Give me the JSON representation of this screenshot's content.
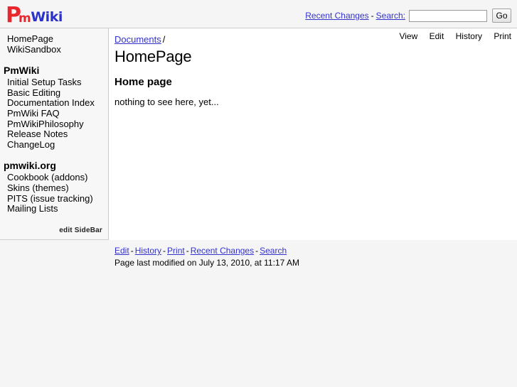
{
  "header": {
    "logo": {
      "p": "P",
      "m": "m",
      "wiki": "Wiki",
      "alt": "PmWiki"
    },
    "recent_changes_label": "Recent Changes",
    "separator": "-",
    "search_label": "Search:",
    "search_value": "",
    "search_placeholder": "",
    "go_label": "Go"
  },
  "action_nav": [
    {
      "label": "View"
    },
    {
      "label": "Edit"
    },
    {
      "label": "History"
    },
    {
      "label": "Print"
    }
  ],
  "sidebar": {
    "top_links": [
      {
        "label": "HomePage"
      },
      {
        "label": "WikiSandbox"
      }
    ],
    "groups": [
      {
        "heading": "PmWiki",
        "items": [
          {
            "label": "Initial Setup Tasks"
          },
          {
            "label": "Basic Editing"
          },
          {
            "label": "Documentation Index"
          },
          {
            "label": "PmWiki FAQ"
          },
          {
            "label": "PmWikiPhilosophy"
          },
          {
            "label": "Release Notes"
          },
          {
            "label": "ChangeLog"
          }
        ]
      },
      {
        "heading": "pmwiki.org",
        "items": [
          {
            "label": "Cookbook (addons)"
          },
          {
            "label": "Skins (themes)"
          },
          {
            "label": "PITS (issue tracking)"
          },
          {
            "label": "Mailing Lists"
          }
        ]
      }
    ],
    "edit_sidebar_label": "edit SideBar"
  },
  "main": {
    "breadcrumb_link": "Documents",
    "breadcrumb_separator": "/",
    "page_title": "HomePage",
    "section_title": "Home page",
    "body_text": "nothing to see here, yet..."
  },
  "footer": {
    "links": [
      {
        "label": "Edit"
      },
      {
        "label": "History"
      },
      {
        "label": "Print"
      },
      {
        "label": "Recent Changes"
      },
      {
        "label": "Search"
      }
    ],
    "separator": "-",
    "last_modified": "Page last modified on July 13, 2010, at 11:17 AM"
  },
  "colors": {
    "link": "#3333cc",
    "logo_red": "#e8262b",
    "logo_blue": "#2b32c9",
    "page_bg": "#f5f5f5",
    "content_bg": "#ffffff",
    "border": "#cccccc"
  }
}
